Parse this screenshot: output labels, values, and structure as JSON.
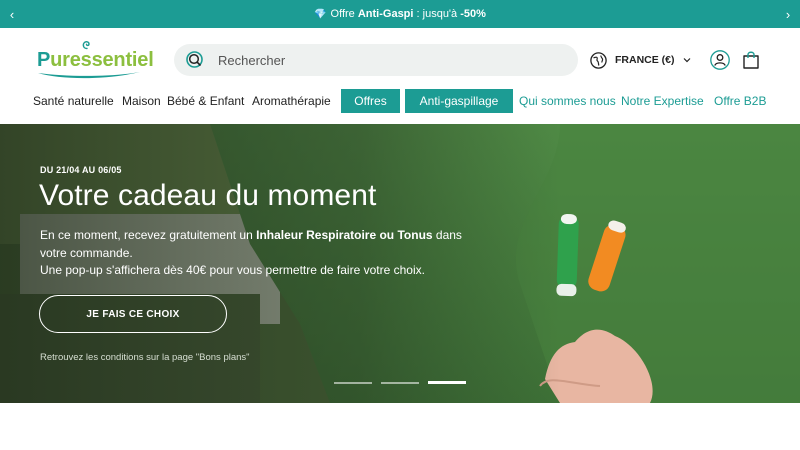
{
  "promo": {
    "prefix": "Offre ",
    "bold1": "Anti-Gaspi",
    "middle": " : jusqu'à ",
    "bold2": "-50%",
    "left_arrow": "‹",
    "right_arrow": "›",
    "gem_icon": "💎"
  },
  "header": {
    "logo": {
      "p": "P",
      "rest": "uressentiel"
    },
    "search_placeholder": "Rechercher",
    "country": "FRANCE (€)"
  },
  "nav": {
    "items": [
      {
        "label": "Santé naturelle",
        "style": "dark"
      },
      {
        "label": "Maison",
        "style": "dark"
      },
      {
        "label": "Bébé & Enfant",
        "style": "dark"
      },
      {
        "label": "Aromathérapie",
        "style": "dark"
      },
      {
        "label": "Offres",
        "style": "pill"
      },
      {
        "label": "Anti-gaspillage",
        "style": "pill"
      },
      {
        "label": "Qui sommes nous",
        "style": "teal"
      },
      {
        "label": "Notre Expertise",
        "style": "teal"
      },
      {
        "label": "Offre B2B",
        "style": "teal"
      }
    ]
  },
  "hero": {
    "dates": "DU 21/04 AU 06/05",
    "title": "Votre cadeau du moment",
    "body_1": "En ce moment, recevez gratuitement un ",
    "body_bold": "Inhaleur Respiratoire ou Tonus",
    "body_2": " dans votre commande.",
    "body_3": "Une pop-up s'affichera dès 40€ pour vous permettre de faire votre choix.",
    "cta": "JE FAIS CE CHOIX",
    "conditions": "Retrouvez les conditions sur la page \"Bons plans\"",
    "slides_total": 3,
    "slide_active": 3
  },
  "colors": {
    "brand_teal": "#1c9c94",
    "brand_green": "#8cbf3f"
  }
}
